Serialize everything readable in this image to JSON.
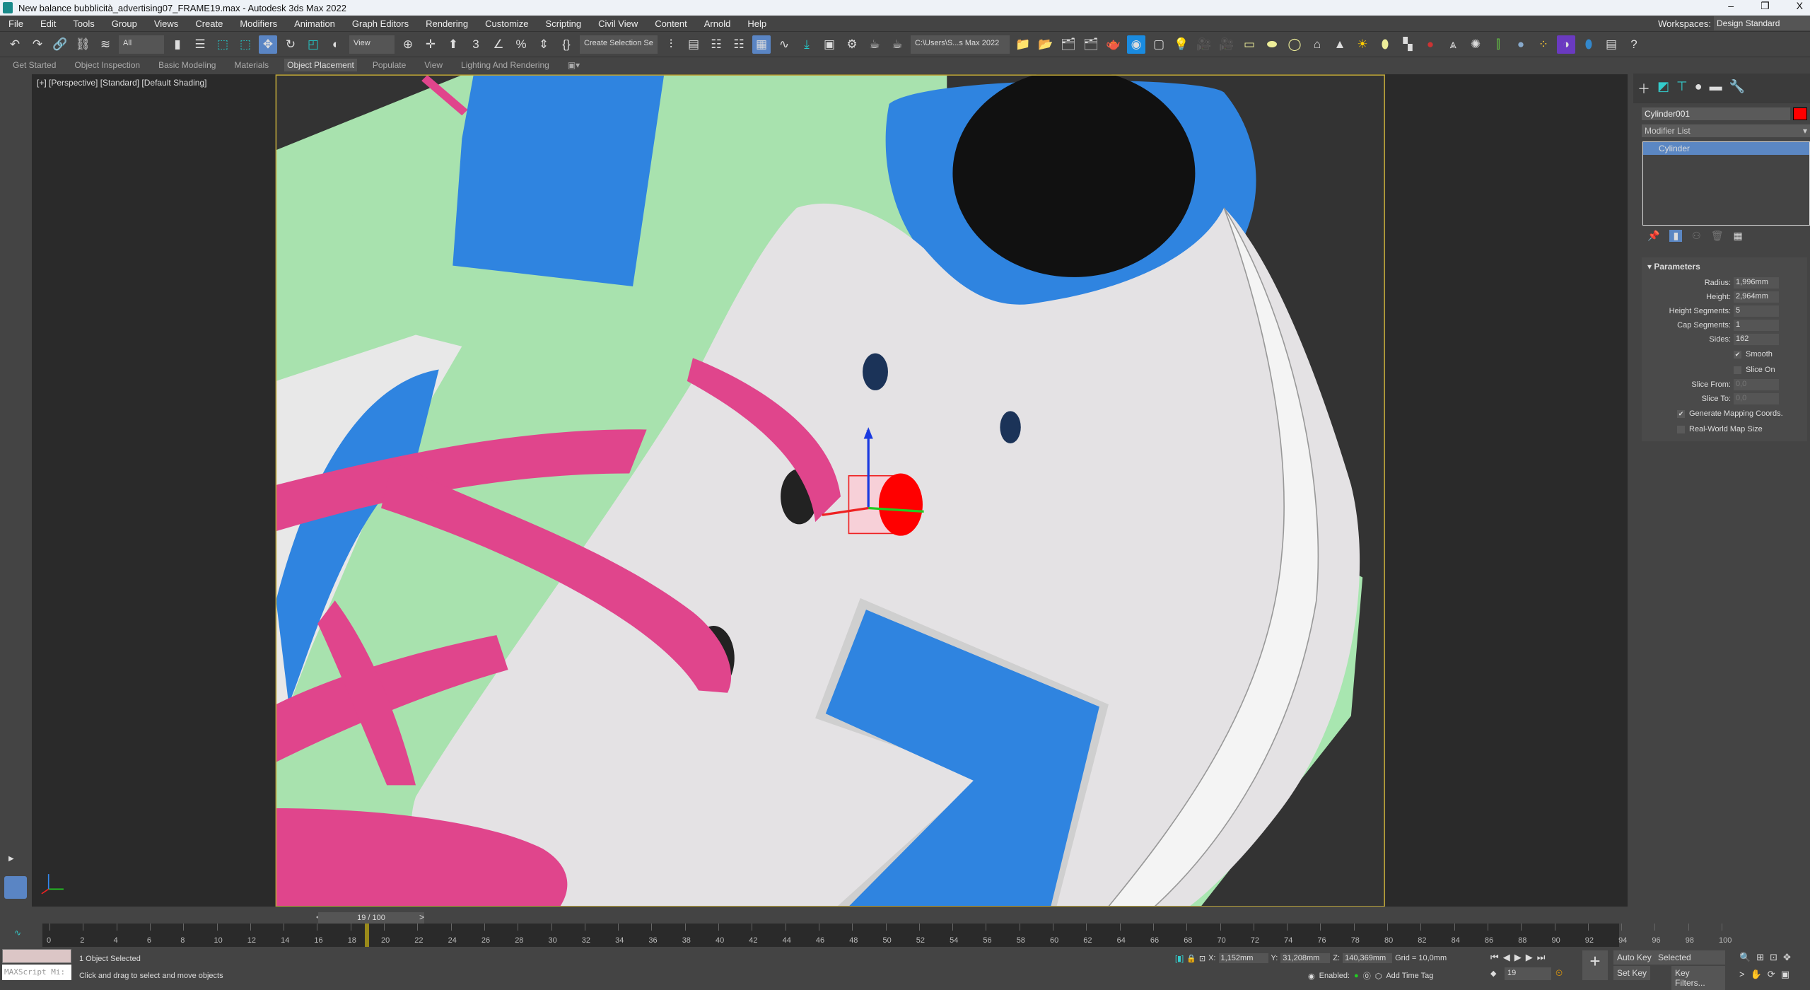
{
  "title": "New balance bubblicità_advertising07_FRAME19.max - Autodesk 3ds Max 2022",
  "window_controls": [
    "–",
    "❐",
    "X"
  ],
  "menu": [
    "File",
    "Edit",
    "Tools",
    "Group",
    "Views",
    "Create",
    "Modifiers",
    "Animation",
    "Graph Editors",
    "Rendering",
    "Customize",
    "Scripting",
    "Civil View",
    "Content",
    "Arnold",
    "Help"
  ],
  "workspace": {
    "label": "Workspaces:",
    "value": "Design Standard"
  },
  "toolbar": {
    "filter": "All",
    "ref_coord": "View",
    "selection_set": "Create Selection Se",
    "project_path": "C:\\Users\\S...s Max 2022"
  },
  "ribbon": {
    "tabs": [
      "Get Started",
      "Object Inspection",
      "Basic Modeling",
      "Materials",
      "Object Placement",
      "Populate",
      "View",
      "Lighting And Rendering"
    ],
    "active": "Object Placement"
  },
  "viewport": {
    "label": "[+] [Perspective] [Standard] [Default Shading]"
  },
  "command_panel": {
    "object_name": "Cylinder001",
    "object_color": "#ff0000",
    "modifier_list": "Modifier List",
    "stack": [
      "Cylinder"
    ],
    "rollout": "Parameters",
    "params": [
      {
        "label": "Radius:",
        "value": "1,996mm"
      },
      {
        "label": "Height:",
        "value": "2,964mm"
      },
      {
        "label": "Height Segments:",
        "value": "5"
      },
      {
        "label": "Cap Segments:",
        "value": "1"
      },
      {
        "label": "Sides:",
        "value": "162"
      }
    ],
    "smooth": {
      "label": "Smooth",
      "checked": true
    },
    "slice_on": {
      "label": "Slice On",
      "checked": false
    },
    "slice_from": {
      "label": "Slice From:",
      "value": "0,0"
    },
    "slice_to": {
      "label": "Slice To:",
      "value": "0,0"
    },
    "gen_mapping": {
      "label": "Generate Mapping Coords.",
      "checked": true
    },
    "real_world": {
      "label": "Real-World Map Size",
      "checked": false
    }
  },
  "timeline": {
    "frame_display": "19 / 100",
    "current": 19,
    "total": 100,
    "ticks": [
      "0",
      "2",
      "4",
      "6",
      "8",
      "10",
      "12",
      "14",
      "16",
      "18",
      "20",
      "22",
      "24",
      "26",
      "28",
      "30",
      "32",
      "34",
      "36",
      "38",
      "40",
      "42",
      "44",
      "46",
      "48",
      "50",
      "52",
      "54",
      "56",
      "58",
      "60",
      "62",
      "64",
      "66",
      "68",
      "70",
      "72",
      "74",
      "76",
      "78",
      "80",
      "82",
      "84",
      "86",
      "88",
      "90",
      "92",
      "94",
      "96",
      "98",
      "100"
    ]
  },
  "status": {
    "selected": "1 Object Selected",
    "prompt": "Click and drag to select and move objects",
    "maxscript": "MAXScript Mi:",
    "x_label": "X:",
    "x": "1,152mm",
    "y_label": "Y:",
    "y": "31,208mm",
    "z_label": "Z:",
    "z": "140,369mm",
    "grid": "Grid = 10,0mm",
    "enabled": "Enabled:",
    "add_time_tag": "Add Time Tag",
    "auto_key": "Auto Key",
    "set_key": "Set Key",
    "key_mode": "Selected",
    "key_filters": "Key Filters...",
    "frame": "19"
  }
}
